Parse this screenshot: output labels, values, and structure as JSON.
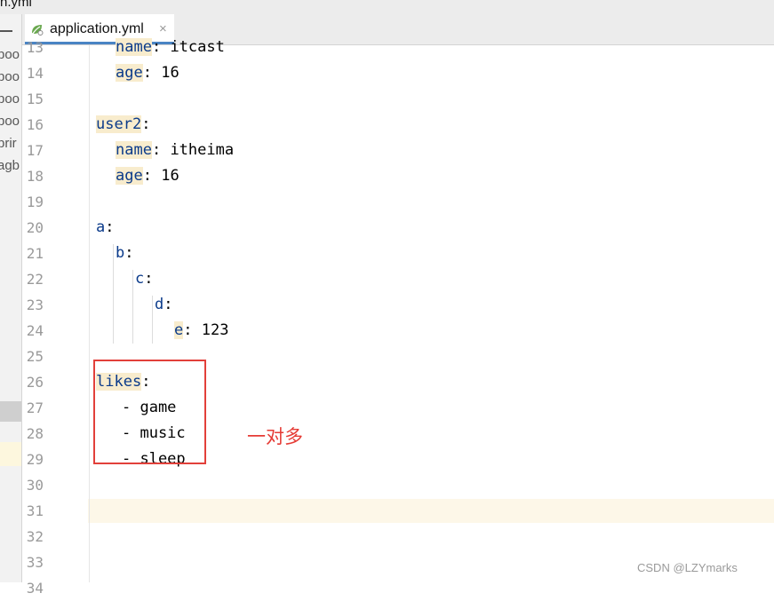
{
  "window": {
    "title_fragment": "n.yml"
  },
  "project_panel": {
    "items": [
      "boo",
      "boo",
      "boo",
      "boo",
      "prir",
      "agb"
    ]
  },
  "tab": {
    "label": "application.yml",
    "close": "×"
  },
  "editor": {
    "lines": [
      {
        "number": "13",
        "key": "name",
        "value": " itcast"
      },
      {
        "number": "14",
        "key": "age",
        "value": " 16"
      },
      {
        "number": "15"
      },
      {
        "number": "16",
        "key": "user2",
        "value": ""
      },
      {
        "number": "17",
        "key": "name",
        "value": " itheima"
      },
      {
        "number": "18",
        "key": "age",
        "value": " 16"
      },
      {
        "number": "19"
      },
      {
        "number": "20",
        "key": "a",
        "value": ""
      },
      {
        "number": "21",
        "key": "b",
        "value": ""
      },
      {
        "number": "22",
        "key": "c",
        "value": ""
      },
      {
        "number": "23",
        "key": "d",
        "value": ""
      },
      {
        "number": "24",
        "key": "e",
        "value": " 123"
      },
      {
        "number": "25"
      },
      {
        "number": "26",
        "key": "likes",
        "value": ""
      },
      {
        "number": "27",
        "item": "- game"
      },
      {
        "number": "28",
        "item": "- music"
      },
      {
        "number": "29",
        "item": "- sleep"
      },
      {
        "number": "30"
      },
      {
        "number": "31"
      },
      {
        "number": "32"
      },
      {
        "number": "33"
      },
      {
        "number": "34"
      }
    ],
    "current_line": "31"
  },
  "annotation": {
    "text": "一对多",
    "color": "#e53b35"
  },
  "watermark": "CSDN @LZYmarks",
  "colors": {
    "key": "#0a3a8a",
    "key_highlight": "#f8eccd",
    "caret_line": "#fdf7e8",
    "tab_underline": "#4a84c4"
  }
}
